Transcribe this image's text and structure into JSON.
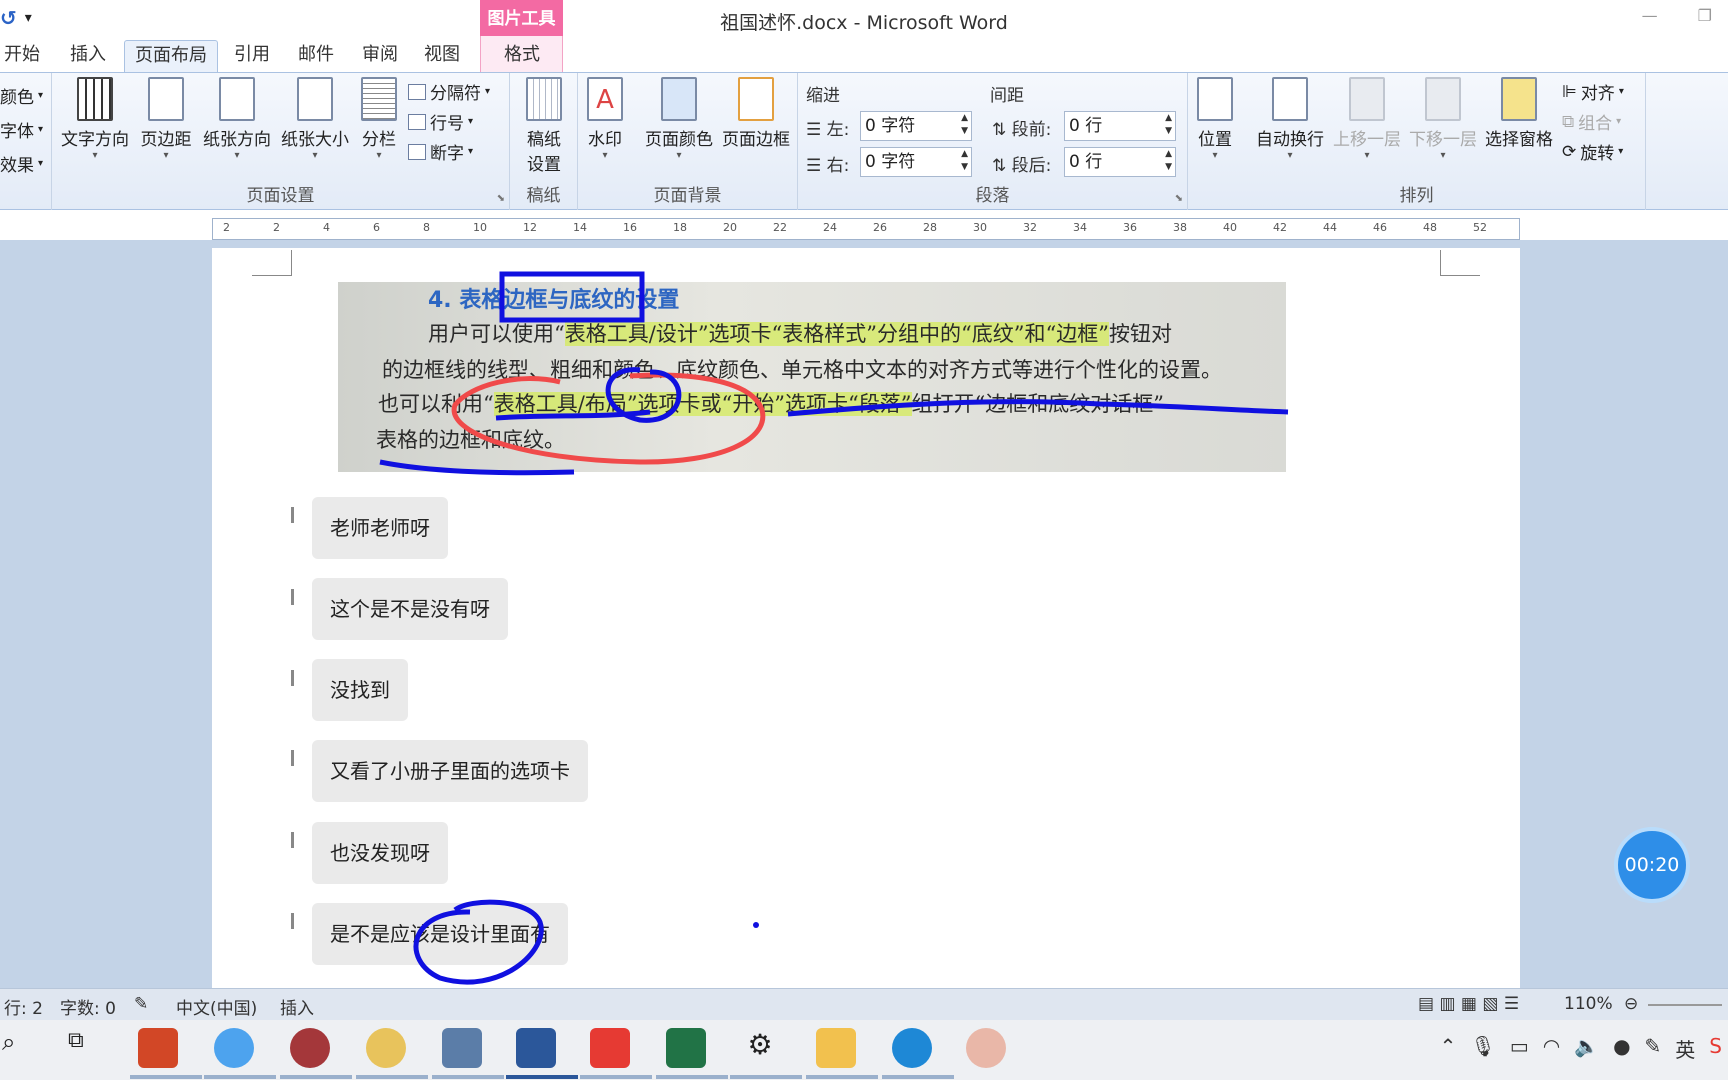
{
  "title_bar": {
    "document_title": "祖国述怀.docx - Microsoft Word",
    "context_tab_group": "图片工具",
    "quick_access": {
      "undo_icon": "undo-icon",
      "customize_icon": "customize-qat-icon"
    }
  },
  "tabs": [
    {
      "label": "开始"
    },
    {
      "label": "插入"
    },
    {
      "label": "页面布局",
      "active": true
    },
    {
      "label": "引用"
    },
    {
      "label": "邮件"
    },
    {
      "label": "审阅"
    },
    {
      "label": "视图"
    },
    {
      "label": "格式"
    }
  ],
  "ribbon": {
    "themes": {
      "colors": "颜色",
      "fonts": "字体",
      "effects": "效果"
    },
    "page_setup": {
      "label": "页面设置",
      "text_direction": "文字方向",
      "margins": "页边距",
      "orientation": "纸张方向",
      "size": "纸张大小",
      "columns": "分栏",
      "breaks": "分隔符",
      "line_numbers": "行号",
      "hyphenation": "断字"
    },
    "manuscript": {
      "label": "稿纸",
      "setup_line1": "稿纸",
      "setup_line2": "设置"
    },
    "page_background": {
      "label": "页面背景",
      "watermark": "水印",
      "page_color": "页面颜色",
      "page_borders": "页面边框"
    },
    "paragraph": {
      "label": "段落",
      "indent_title": "缩进",
      "indent_left_label": "左:",
      "indent_left_value": "0 字符",
      "indent_right_label": "右:",
      "indent_right_value": "0 字符",
      "spacing_title": "间距",
      "spacing_before_label": "段前:",
      "spacing_before_value": "0 行",
      "spacing_after_label": "段后:",
      "spacing_after_value": "0 行"
    },
    "arrange": {
      "label": "排列",
      "position": "位置",
      "wrap_text": "自动换行",
      "bring_forward": "上移一层",
      "send_backward": "下移一层",
      "selection_pane": "选择窗格",
      "align": "对齐",
      "group": "组合",
      "rotate": "旋转"
    }
  },
  "ruler": {
    "ticks": [
      "2",
      "2",
      "4",
      "6",
      "8",
      "10",
      "12",
      "14",
      "16",
      "18",
      "20",
      "22",
      "24",
      "26",
      "28",
      "30",
      "32",
      "34",
      "36",
      "38",
      "40",
      "42",
      "44",
      "46",
      "48",
      "52"
    ]
  },
  "photo": {
    "heading": "4. 表格边框与底纹的设置",
    "line1_pre": "用户可以使用“",
    "line1_hl": "表格工具/设计”选项卡“表格样式”分组中的“底纹”和“边框”",
    "line1_post": "按钮对",
    "line2": "的边框线的线型、粗细和颜色、底纹颜色、单元格中文本的对齐方式等进行个性化的设置。",
    "line3_pre": "也可以利用“",
    "line3_hl": "表格工具/布局”选项卡或“开始”选项卡“段落”",
    "line3_post": "组打开“边框和底纹对话框”",
    "line4": "表格的边框和底纹。"
  },
  "messages": [
    {
      "text": "老师老师呀"
    },
    {
      "text": "这个是不是没有呀"
    },
    {
      "text": "没找到"
    },
    {
      "text": "又看了小册子里面的选项卡"
    },
    {
      "text": "也没发现呀"
    },
    {
      "text": "是不是应该是设计里面有"
    }
  ],
  "status_bar": {
    "line": "行: 2",
    "word_count": "字数: 0",
    "language": "中文(中国)",
    "insert_mode": "插入",
    "zoom": "110%"
  },
  "timer": "00:20",
  "taskbar": {
    "icons": [
      "search-icon",
      "task-view-icon",
      "powerpoint-icon",
      "baidu-netdisk-icon",
      "access-icon",
      "paint-icon",
      "calculator-icon",
      "word-icon",
      "pdf-icon",
      "excel-icon",
      "settings-icon",
      "file-explorer-icon",
      "edge-icon",
      "avatar-app-icon"
    ],
    "ime": "英"
  },
  "colors": {
    "ribbon_bg": "#e3ebf7",
    "context_tab": "#f36aa3",
    "doc_bg": "#c3d3e7",
    "annot_blue": "#1010e0",
    "annot_red": "#f04a4a",
    "highlight": "#d4eb5a",
    "timer": "#2e8ee8"
  }
}
